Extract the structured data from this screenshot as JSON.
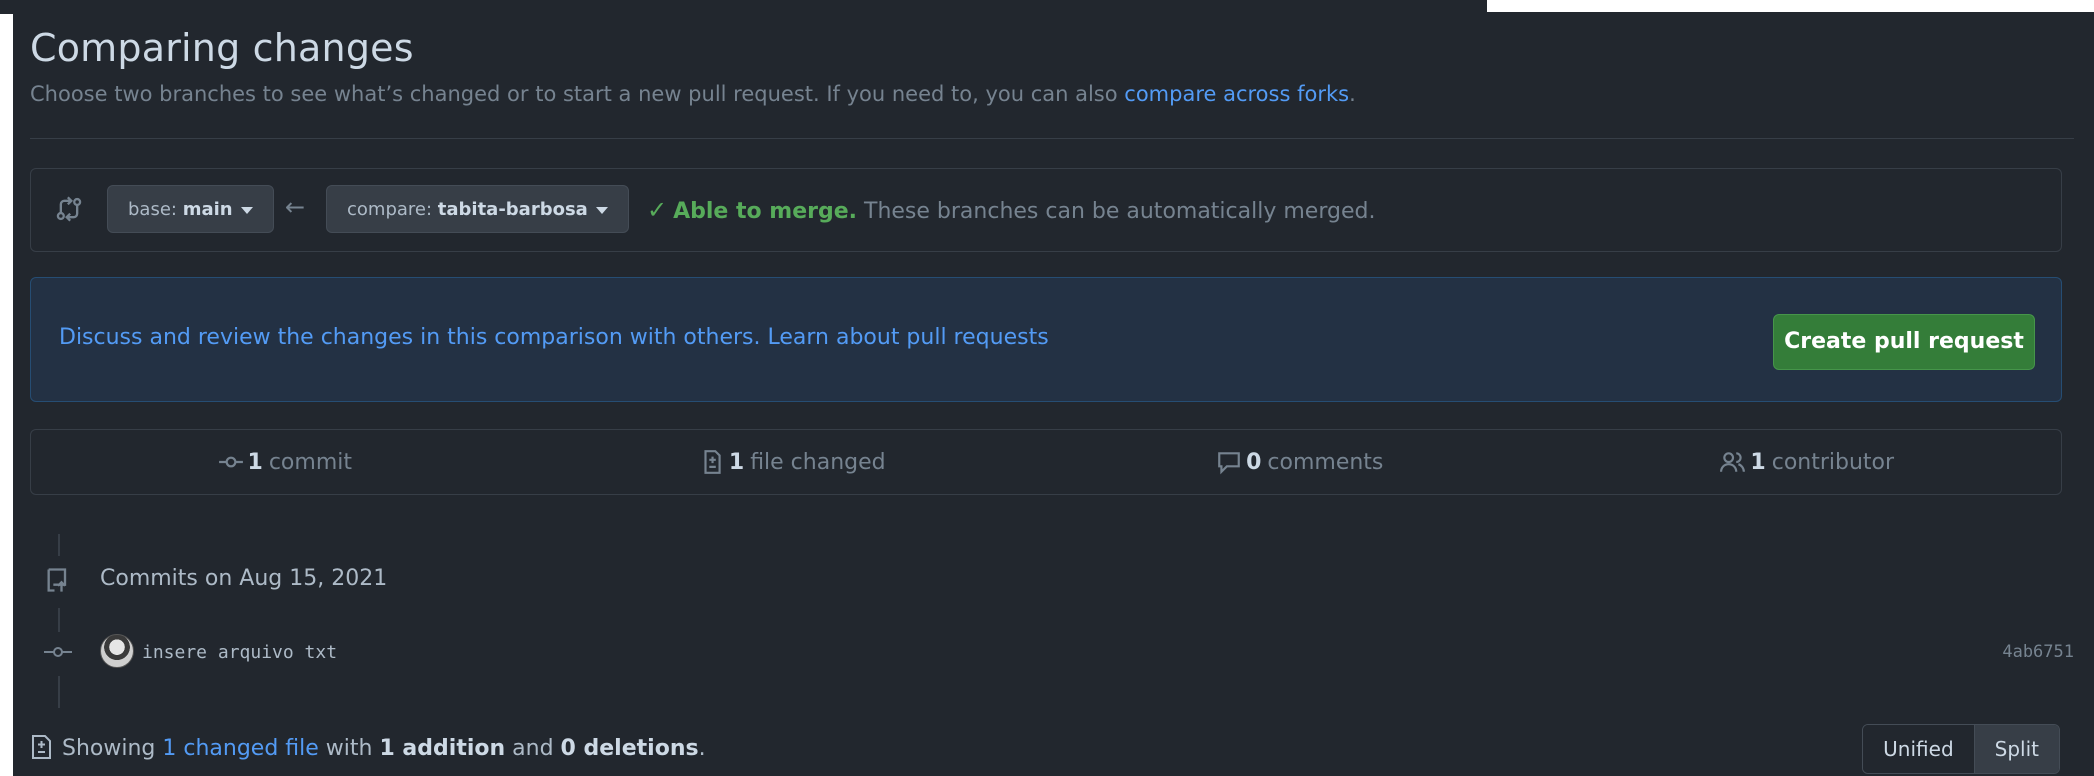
{
  "page": {
    "title": "Comparing changes",
    "subtitle_text": "Choose two branches to see what’s changed or to start a new pull request. If you need to, you can also ",
    "subtitle_link": "compare across forks",
    "subtitle_end": "."
  },
  "range": {
    "base_prefix": "base: ",
    "base_branch": "main",
    "compare_prefix": "compare: ",
    "compare_branch": "tabita-barbosa",
    "merge_ok": "Able to merge.",
    "merge_detail": " These branches can be automatically merged."
  },
  "discuss": {
    "text": "Discuss and review the changes in this comparison with others. ",
    "link": "Learn about pull requests",
    "button": "Create pull request"
  },
  "stats": {
    "commits_count": "1",
    "commits_label": "commit",
    "files_count": "1",
    "files_label": "file changed",
    "comments_count": "0",
    "comments_label": "comments",
    "contributors_count": "1",
    "contributors_label": "contributor"
  },
  "commits": {
    "group_label": "Commits on Aug 15, 2021",
    "items": [
      {
        "message": "insere arquivo txt",
        "sha": "4ab6751"
      }
    ]
  },
  "footer": {
    "showing": "Showing ",
    "changed_link": "1 changed file",
    "with": " with ",
    "additions": "1 addition",
    "and": " and ",
    "deletions": "0 deletions",
    "end": ".",
    "unified": "Unified",
    "split": "Split"
  },
  "colors": {
    "background": "#22272e",
    "link": "#539bf5",
    "success": "#57ab5a",
    "primary_button": "#347d39"
  }
}
